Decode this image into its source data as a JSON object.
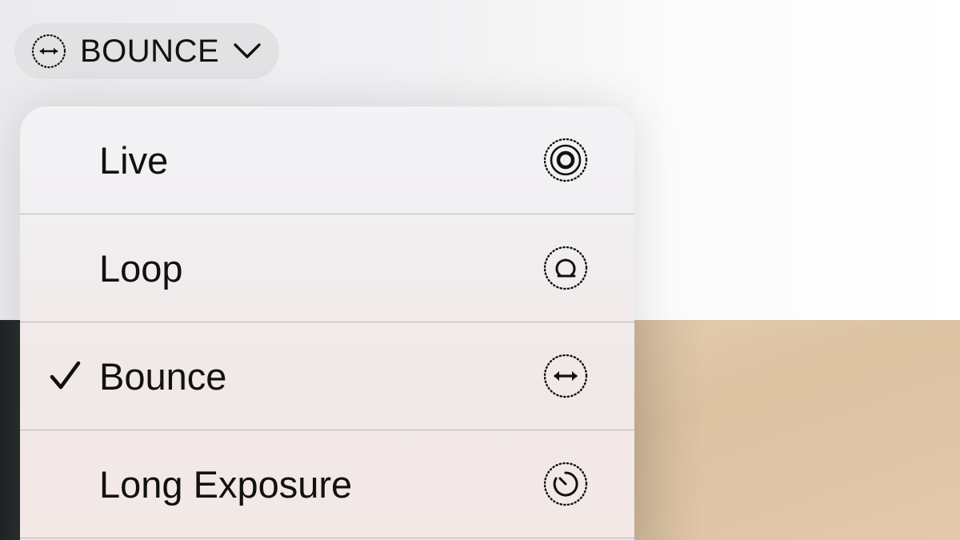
{
  "header": {
    "mode_label": "BOUNCE",
    "mode_icon": "bounce-arrows-icon",
    "chevron_icon": "chevron-down-icon"
  },
  "menu": {
    "items": [
      {
        "label": "Live",
        "icon": "live-photo-icon",
        "selected": false
      },
      {
        "label": "Loop",
        "icon": "loop-icon",
        "selected": false
      },
      {
        "label": "Bounce",
        "icon": "bounce-icon",
        "selected": true
      },
      {
        "label": "Long Exposure",
        "icon": "long-exposure-icon",
        "selected": false
      }
    ],
    "check_icon": "checkmark-icon"
  },
  "colors": {
    "text": "#111111",
    "pill_bg": "#e2e2e4",
    "menu_bg": "#f3f3f5",
    "divider": "#b7b7ba"
  }
}
